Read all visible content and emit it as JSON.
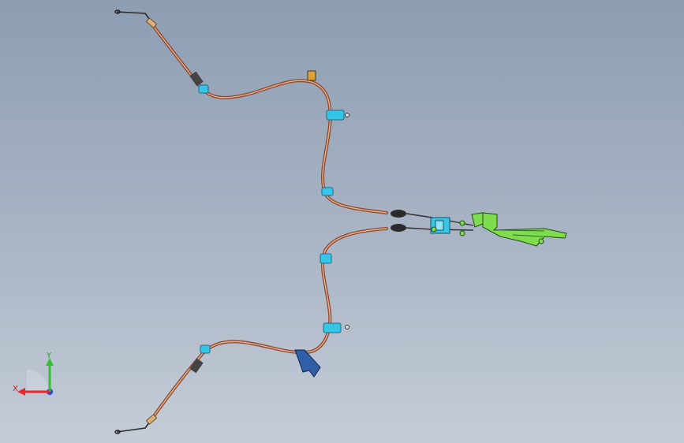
{
  "viewport": {
    "background_top": "#8d9db2",
    "background_bottom": "#c4ccd7"
  },
  "model": {
    "part_colors": {
      "outer_cable": "#9a4f3e",
      "inner_cable": "#e0b27a",
      "clip": "#35c5e6",
      "bracket_blue": "#2f5fa8",
      "equalizer_bracket": "#7fdc4f",
      "end_fitting": "#2b2b2b"
    }
  },
  "triad": {
    "x_label": "X",
    "y_label": "Y",
    "x_color": "#e8262b",
    "y_color": "#2fc42f",
    "z_color": "#2544e6"
  }
}
